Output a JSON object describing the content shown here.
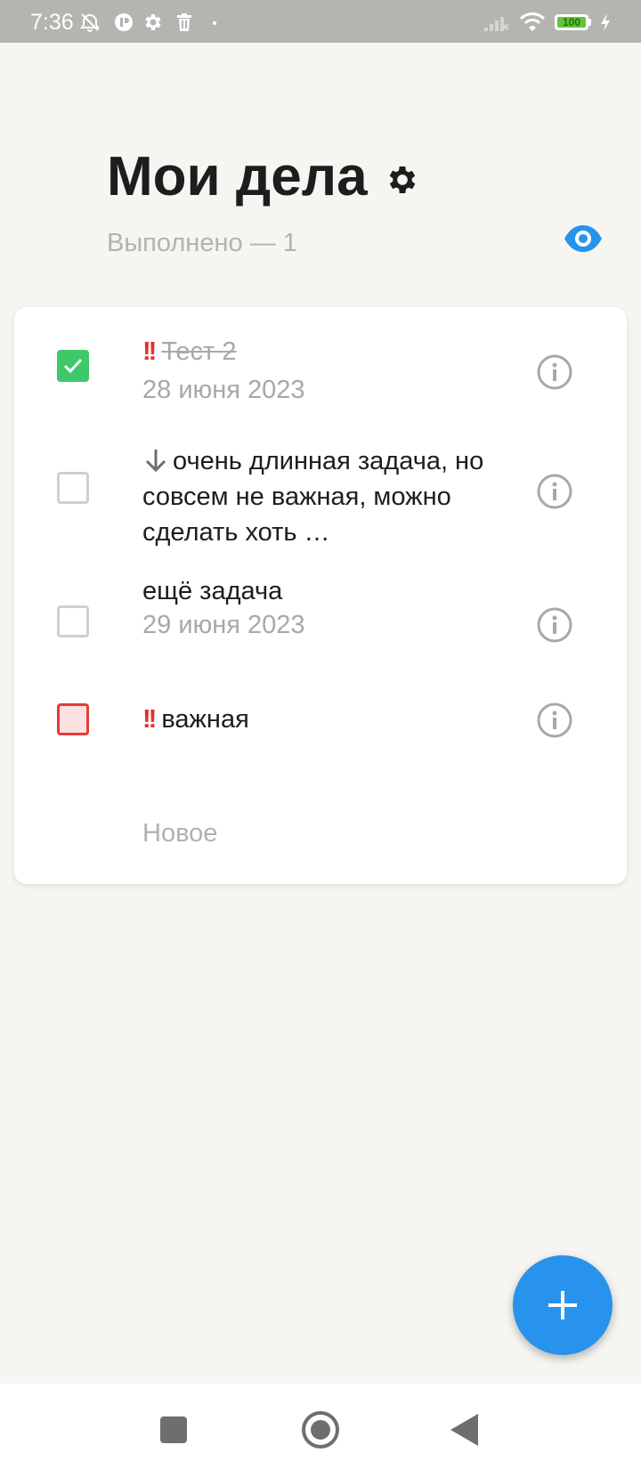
{
  "status_bar": {
    "time": "7:36",
    "battery": "100",
    "icons": [
      "alarm-off-icon",
      "app-notification-icon",
      "gear-icon",
      "trash-icon",
      "signal-icon",
      "wifi-icon",
      "battery-icon",
      "charging-icon"
    ]
  },
  "header": {
    "title": "Мои дела",
    "completed_label": "Выполнено — 1"
  },
  "tasks": [
    {
      "priority": "!!",
      "label": "Тест 2",
      "date": "28 июня 2023",
      "done": true
    },
    {
      "priority": "low",
      "label": "очень длинная задача, но совсем не важная, можно сделать хоть …",
      "done": false
    },
    {
      "label": "ещё задача",
      "date": "29 июня 2023",
      "done": false
    },
    {
      "priority": "!!",
      "label": "важная",
      "done": false
    }
  ],
  "new_task_placeholder": "Новое",
  "colors": {
    "accent": "#2793ec",
    "checked": "#3fc86a",
    "important": "#e0332b",
    "background": "#f6f5f2"
  }
}
